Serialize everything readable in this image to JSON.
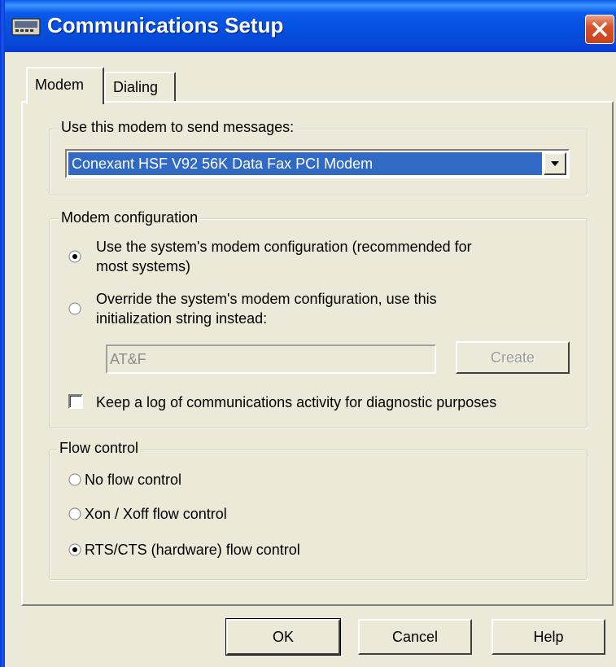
{
  "window": {
    "title": "Communications Setup"
  },
  "tabs": [
    {
      "label": "Modem",
      "selected": true
    },
    {
      "label": "Dialing",
      "selected": false
    }
  ],
  "modem_group": {
    "legend": "Use this modem to send messages:",
    "selected_modem": "Conexant HSF V92 56K Data Fax PCI Modem"
  },
  "config_group": {
    "legend": "Modem configuration",
    "option_system": {
      "line1": "Use the system's modem configuration (recommended for",
      "line2": "most systems)",
      "checked": true
    },
    "option_override": {
      "line1": "Override the system's modem configuration, use this",
      "line2": "initialization string instead:",
      "checked": false
    },
    "init_string": "AT&F",
    "create_label": "Create",
    "log_label": "Keep a log of communications activity for diagnostic purposes",
    "log_checked": false
  },
  "flow_group": {
    "legend": "Flow control",
    "options": [
      {
        "label": "No flow control",
        "checked": false
      },
      {
        "label": "Xon / Xoff flow control",
        "checked": false
      },
      {
        "label": "RTS/CTS (hardware) flow control",
        "checked": true
      }
    ]
  },
  "buttons": {
    "ok": "OK",
    "cancel": "Cancel",
    "help": "Help"
  },
  "colors": {
    "titlebar": "#0a5ae9",
    "selection": "#316ac5",
    "dialog_bg": "#ece9d8",
    "close": "#d9532b"
  },
  "icons": {
    "title": "modem-icon",
    "close": "close-icon",
    "dropdown": "chevron-down-icon"
  }
}
